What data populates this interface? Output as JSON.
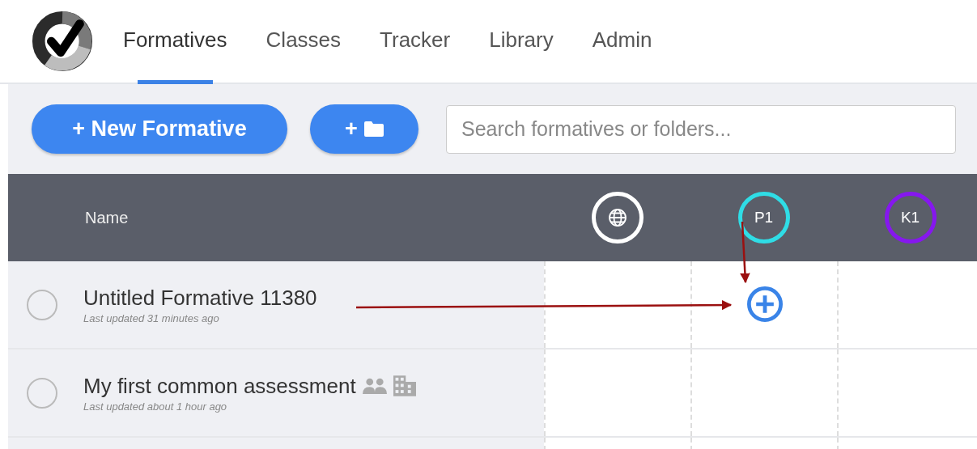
{
  "nav": {
    "tabs": [
      {
        "label": "Formatives",
        "selected": true
      },
      {
        "label": "Classes",
        "selected": false
      },
      {
        "label": "Tracker",
        "selected": false
      },
      {
        "label": "Library",
        "selected": false
      },
      {
        "label": "Admin",
        "selected": false
      }
    ]
  },
  "toolbar": {
    "new_button": "+ New Formative",
    "folder_button": "+",
    "search": {
      "placeholder": "Search formatives or folders..."
    }
  },
  "table": {
    "name_header": "Name",
    "columns": [
      {
        "kind": "globe"
      },
      {
        "kind": "initials",
        "label": "P1",
        "color": "#2fdde6"
      },
      {
        "kind": "initials",
        "label": "K1",
        "color": "#8617ef"
      }
    ],
    "rows": [
      {
        "name": "Untitled Formative 11380",
        "updated": "Last updated 31 minutes ago",
        "selected": false,
        "team_shared": false,
        "school_shared": false,
        "cells": [
          {
            "kind": "empty"
          },
          {
            "kind": "add"
          },
          {
            "kind": "empty"
          }
        ]
      },
      {
        "name": "My first common assessment",
        "updated": "Last updated about 1 hour ago",
        "selected": false,
        "team_shared": true,
        "school_shared": true,
        "cells": [
          {
            "kind": "empty"
          },
          {
            "kind": "empty"
          },
          {
            "kind": "empty"
          }
        ]
      },
      {
        "cells": [
          {
            "kind": "empty"
          },
          {
            "kind": "empty"
          },
          {
            "kind": "empty"
          }
        ]
      }
    ]
  }
}
